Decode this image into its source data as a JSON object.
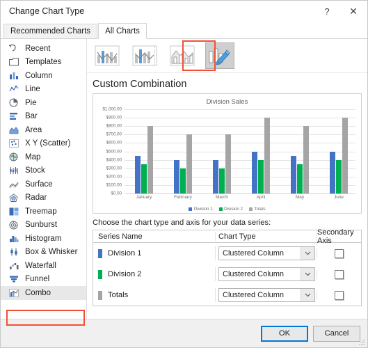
{
  "window": {
    "title": "Change Chart Type",
    "help_icon": "question-mark-icon",
    "close_icon": "close-icon"
  },
  "tabs": [
    {
      "label": "Recommended Charts",
      "active": false
    },
    {
      "label": "All Charts",
      "active": true
    }
  ],
  "sidebar": {
    "items": [
      {
        "label": "Recent",
        "icon": "recent-icon",
        "selected": false
      },
      {
        "label": "Templates",
        "icon": "templates-icon",
        "selected": false
      },
      {
        "label": "Column",
        "icon": "column-chart-icon",
        "selected": false
      },
      {
        "label": "Line",
        "icon": "line-chart-icon",
        "selected": false
      },
      {
        "label": "Pie",
        "icon": "pie-chart-icon",
        "selected": false
      },
      {
        "label": "Bar",
        "icon": "bar-chart-icon",
        "selected": false
      },
      {
        "label": "Area",
        "icon": "area-chart-icon",
        "selected": false
      },
      {
        "label": "X Y (Scatter)",
        "icon": "scatter-chart-icon",
        "selected": false
      },
      {
        "label": "Map",
        "icon": "map-chart-icon",
        "selected": false
      },
      {
        "label": "Stock",
        "icon": "stock-chart-icon",
        "selected": false
      },
      {
        "label": "Surface",
        "icon": "surface-chart-icon",
        "selected": false
      },
      {
        "label": "Radar",
        "icon": "radar-chart-icon",
        "selected": false
      },
      {
        "label": "Treemap",
        "icon": "treemap-chart-icon",
        "selected": false
      },
      {
        "label": "Sunburst",
        "icon": "sunburst-chart-icon",
        "selected": false
      },
      {
        "label": "Histogram",
        "icon": "histogram-chart-icon",
        "selected": false
      },
      {
        "label": "Box & Whisker",
        "icon": "box-whisker-chart-icon",
        "selected": false
      },
      {
        "label": "Waterfall",
        "icon": "waterfall-chart-icon",
        "selected": false
      },
      {
        "label": "Funnel",
        "icon": "funnel-chart-icon",
        "selected": false
      },
      {
        "label": "Combo",
        "icon": "combo-chart-icon",
        "selected": true
      }
    ]
  },
  "thumbnails": [
    {
      "name": "clustered-column-line",
      "selected": false
    },
    {
      "name": "clustered-column-line-on-secondary-axis",
      "selected": false
    },
    {
      "name": "stacked-area-clustered-column",
      "selected": false
    },
    {
      "name": "custom-combination",
      "selected": true
    }
  ],
  "preview": {
    "variant_name": "Custom Combination"
  },
  "chart_data": {
    "type": "bar",
    "title": "Division Sales",
    "xlabel": "",
    "ylabel": "",
    "categories": [
      "January",
      "February",
      "March",
      "April",
      "May",
      "June"
    ],
    "series": [
      {
        "name": "Division 1",
        "color": "#4472c4",
        "values": [
          450,
          400,
          400,
          500,
          450,
          500
        ]
      },
      {
        "name": "Division 2",
        "color": "#00b050",
        "values": [
          350,
          300,
          300,
          400,
          350,
          400
        ]
      },
      {
        "name": "Totals",
        "color": "#a5a5a5",
        "values": [
          800,
          700,
          700,
          900,
          800,
          900
        ]
      }
    ],
    "ylim": [
      0,
      1000
    ],
    "ytick_values": [
      0,
      100,
      200,
      300,
      400,
      500,
      600,
      700,
      800,
      900,
      1000
    ],
    "ytick_labels": [
      "$0.00",
      "$100.00",
      "$200.00",
      "$300.00",
      "$400.00",
      "$500.00",
      "$600.00",
      "$700.00",
      "$800.00",
      "$900.00",
      "$1,000.00"
    ],
    "grid": true,
    "legend": "bottom"
  },
  "series_table": {
    "prompt": "Choose the chart type and axis for your data series:",
    "headers": {
      "series_name": "Series Name",
      "chart_type": "Chart Type",
      "secondary_axis": "Secondary Axis"
    },
    "rows": [
      {
        "series_name": "Division 1",
        "color": "#4472c4",
        "chart_type": "Clustered Column",
        "secondary_axis": false
      },
      {
        "series_name": "Division 2",
        "color": "#00b050",
        "chart_type": "Clustered Column",
        "secondary_axis": false
      },
      {
        "series_name": "Totals",
        "color": "#a5a5a5",
        "chart_type": "Clustered Column",
        "secondary_axis": false
      }
    ]
  },
  "footer": {
    "ok_label": "OK",
    "cancel_label": "Cancel"
  },
  "annotations": {
    "highlight_color": "#ef5136"
  }
}
